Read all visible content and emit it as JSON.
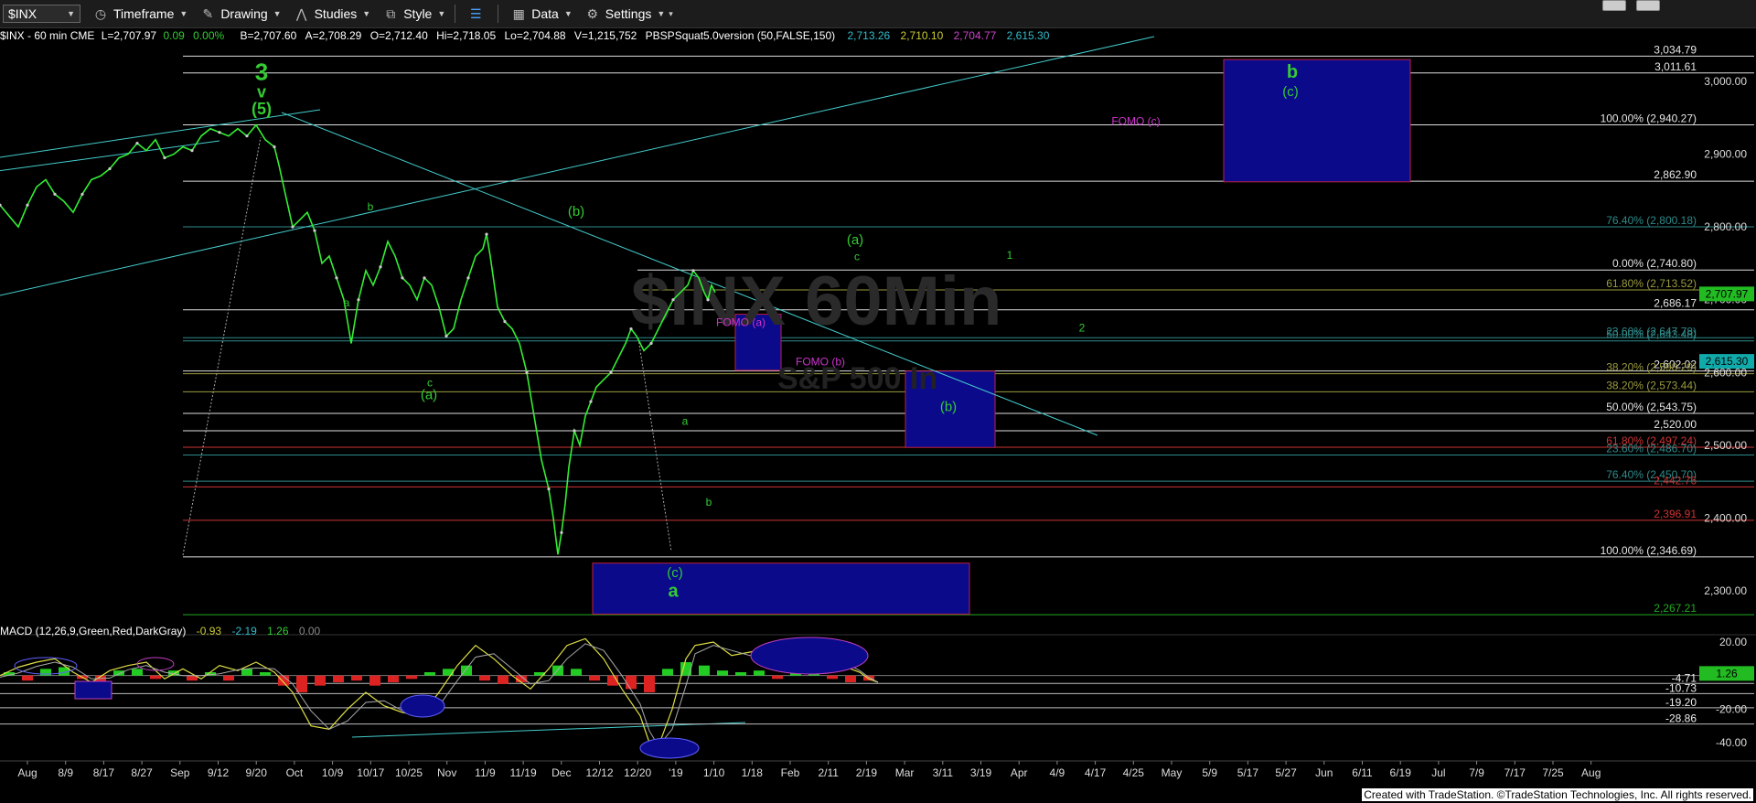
{
  "toolbar": {
    "symbol": "$INX",
    "timeframe": "Timeframe",
    "drawing": "Drawing",
    "studies": "Studies",
    "style": "Style",
    "data": "Data",
    "settings": "Settings"
  },
  "header": {
    "symbol_info": "$INX - 60 min  CME",
    "last": "L=2,707.97",
    "chg": "0.09",
    "pct": "0.00%",
    "bid": "B=2,707.60",
    "ask": "A=2,708.29",
    "open": "O=2,712.40",
    "high": "Hi=2,718.05",
    "low": "Lo=2,704.88",
    "vol": "V=1,215,752",
    "study": "PBSPSquat5.0version (50,FALSE,150)",
    "v1": "2,713.26",
    "v2": "2,710.10",
    "v3": "2,704.77",
    "v4": "2,615.30"
  },
  "macd_header": {
    "label": "MACD (12,26,9,Green,Red,DarkGray)",
    "v1": "-0.93",
    "v2": "-2.19",
    "v3": "1.26",
    "v4": "0.00"
  },
  "watermark": {
    "line1": "$INX 60Min",
    "line2": "S&P 500 In"
  },
  "footer": "Created with TradeStation. ©TradeStation Technologies, Inc. All rights reserved.",
  "chart_data": {
    "type": "line",
    "title": "$INX - 60 min",
    "ylim": [
      2240,
      3060
    ],
    "price_ticks": [
      "3,000.00",
      "2,900.00",
      "2,800.00",
      "2,700.00",
      "2,600.00",
      "2,500.00",
      "2,400.00",
      "2,300.00"
    ],
    "x_ticks": [
      "Aug",
      "8/9",
      "8/17",
      "8/27",
      "Sep",
      "9/12",
      "9/20",
      "Oct",
      "10/9",
      "10/17",
      "10/25",
      "Nov",
      "11/9",
      "11/19",
      "Dec",
      "12/12",
      "12/20",
      "'19",
      "1/10",
      "1/18",
      "Feb",
      "2/11",
      "2/19",
      "Mar",
      "3/11",
      "3/19",
      "Apr",
      "4/9",
      "4/17",
      "4/25",
      "May",
      "5/9",
      "5/17",
      "5/27",
      "Jun",
      "6/11",
      "6/19",
      "Jul",
      "7/9",
      "7/17",
      "7/25",
      "Aug"
    ],
    "price_series": [
      [
        0,
        2830
      ],
      [
        10,
        2815
      ],
      [
        20,
        2800
      ],
      [
        30,
        2830
      ],
      [
        40,
        2855
      ],
      [
        50,
        2865
      ],
      [
        60,
        2845
      ],
      [
        70,
        2835
      ],
      [
        80,
        2820
      ],
      [
        90,
        2845
      ],
      [
        100,
        2865
      ],
      [
        110,
        2870
      ],
      [
        120,
        2880
      ],
      [
        130,
        2895
      ],
      [
        140,
        2900
      ],
      [
        150,
        2915
      ],
      [
        160,
        2905
      ],
      [
        170,
        2920
      ],
      [
        180,
        2895
      ],
      [
        190,
        2900
      ],
      [
        200,
        2910
      ],
      [
        210,
        2905
      ],
      [
        220,
        2925
      ],
      [
        230,
        2935
      ],
      [
        240,
        2930
      ],
      [
        250,
        2925
      ],
      [
        260,
        2935
      ],
      [
        270,
        2925
      ],
      [
        280,
        2940
      ],
      [
        290,
        2920
      ],
      [
        300,
        2910
      ],
      [
        305,
        2885
      ],
      [
        312,
        2845
      ],
      [
        320,
        2800
      ],
      [
        328,
        2810
      ],
      [
        336,
        2820
      ],
      [
        344,
        2795
      ],
      [
        352,
        2750
      ],
      [
        360,
        2760
      ],
      [
        368,
        2730
      ],
      [
        376,
        2700
      ],
      [
        384,
        2640
      ],
      [
        392,
        2700
      ],
      [
        400,
        2740
      ],
      [
        408,
        2720
      ],
      [
        416,
        2745
      ],
      [
        424,
        2780
      ],
      [
        432,
        2760
      ],
      [
        440,
        2730
      ],
      [
        448,
        2720
      ],
      [
        456,
        2700
      ],
      [
        464,
        2730
      ],
      [
        472,
        2720
      ],
      [
        480,
        2690
      ],
      [
        488,
        2650
      ],
      [
        496,
        2660
      ],
      [
        504,
        2700
      ],
      [
        512,
        2730
      ],
      [
        520,
        2760
      ],
      [
        528,
        2770
      ],
      [
        532,
        2790
      ],
      [
        536,
        2760
      ],
      [
        544,
        2690
      ],
      [
        552,
        2670
      ],
      [
        560,
        2660
      ],
      [
        568,
        2640
      ],
      [
        576,
        2600
      ],
      [
        584,
        2540
      ],
      [
        592,
        2480
      ],
      [
        600,
        2440
      ],
      [
        605,
        2400
      ],
      [
        610,
        2350
      ],
      [
        614,
        2380
      ],
      [
        618,
        2420
      ],
      [
        622,
        2470
      ],
      [
        628,
        2520
      ],
      [
        634,
        2500
      ],
      [
        640,
        2540
      ],
      [
        646,
        2560
      ],
      [
        652,
        2580
      ],
      [
        660,
        2590
      ],
      [
        668,
        2600
      ],
      [
        676,
        2620
      ],
      [
        684,
        2640
      ],
      [
        690,
        2660
      ],
      [
        696,
        2650
      ],
      [
        704,
        2630
      ],
      [
        712,
        2640
      ],
      [
        720,
        2660
      ],
      [
        728,
        2680
      ],
      [
        736,
        2700
      ],
      [
        744,
        2710
      ],
      [
        752,
        2720
      ],
      [
        758,
        2740
      ],
      [
        764,
        2730
      ],
      [
        770,
        2710
      ],
      [
        774,
        2700
      ],
      [
        778,
        2720
      ],
      [
        782,
        2710
      ]
    ],
    "levels": [
      {
        "label": "3,034.79",
        "price": 3034.79,
        "color": "#dddddd"
      },
      {
        "label": "3,011.61",
        "price": 3011.61,
        "color": "#dddddd"
      },
      {
        "label": "100.00% (2,940.27)",
        "price": 2940.27,
        "color": "#dddddd"
      },
      {
        "label": "2,862.90",
        "price": 2862.9,
        "color": "#dddddd"
      },
      {
        "label": "76.40% (2,800.18)",
        "price": 2800.18,
        "color": "#2f8a8a"
      },
      {
        "label": "0.00% (2,740.80)",
        "price": 2740.8,
        "color": "#dddddd"
      },
      {
        "label": "61.80% (2,713.52)",
        "price": 2713.52,
        "color": "#9a9a40"
      },
      {
        "label": "2,686.17",
        "price": 2686.17,
        "color": "#dddddd"
      },
      {
        "label": "23.60% (2,647.78)",
        "price": 2647.78,
        "color": "#2f8a8a"
      },
      {
        "label": "50.00% (2,643.48)",
        "price": 2643.48,
        "color": "#2f8a8a"
      },
      {
        "label": "2,602.02",
        "price": 2602.02,
        "color": "#dddddd"
      },
      {
        "label": "38.20% (2,598.29)",
        "price": 2598.29,
        "color": "#9a9a40"
      },
      {
        "label": "38.20% (2,573.44)",
        "price": 2573.44,
        "color": "#9a9a40"
      },
      {
        "label": "50.00% (2,543.75)",
        "price": 2543.75,
        "color": "#dddddd"
      },
      {
        "label": "2,520.00",
        "price": 2520.0,
        "color": "#dddddd"
      },
      {
        "label": "61.80% (2,497.24)",
        "price": 2497.24,
        "color": "#cc3333"
      },
      {
        "label": "23.60% (2,486.70)",
        "price": 2486.7,
        "color": "#2f8a8a"
      },
      {
        "label": "76.40% (2,450.70)",
        "price": 2450.7,
        "color": "#2f8a8a"
      },
      {
        "label": "2,442.76",
        "price": 2442.76,
        "color": "#cc3333"
      },
      {
        "label": "2,396.91",
        "price": 2396.91,
        "color": "#cc3333"
      },
      {
        "label": "100.00% (2,346.69)",
        "price": 2346.69,
        "color": "#dddddd"
      },
      {
        "label": "2,267.21",
        "price": 2267.21,
        "color": "#22aa22"
      }
    ],
    "last_price": {
      "label": "2,707.97",
      "price": 2707.97
    },
    "alt_price": {
      "label": "2,615.30",
      "price": 2615.3
    },
    "boxes": [
      {
        "name": "target-box-b",
        "x1": 1338,
        "x2": 1542,
        "p1": 3030,
        "p2": 2862
      },
      {
        "name": "target-box-b-wave",
        "x1": 990,
        "x2": 1088,
        "p1": 2602,
        "p2": 2497
      },
      {
        "name": "target-box-a",
        "x1": 648,
        "x2": 1060,
        "p1": 2338,
        "p2": 2268
      },
      {
        "name": "fomo-box-a",
        "x1": 804,
        "x2": 854,
        "p1": 2680,
        "p2": 2603
      }
    ],
    "annotations": [
      {
        "text": "3",
        "x": 286,
        "p": 3002,
        "color": "#33cc33",
        "size": 26,
        "bold": true
      },
      {
        "text": "v",
        "x": 286,
        "p": 2978,
        "color": "#33cc33",
        "size": 18,
        "bold": true
      },
      {
        "text": "(5)",
        "x": 286,
        "p": 2955,
        "color": "#33cc33",
        "size": 18,
        "bold": true
      },
      {
        "text": "b",
        "x": 1413,
        "p": 3005,
        "color": "#33cc33",
        "size": 20,
        "bold": true
      },
      {
        "text": "(c)",
        "x": 1411,
        "p": 2980,
        "color": "#33cc33",
        "size": 15,
        "bold": false
      },
      {
        "text": "FOMO (c)",
        "x": 1242,
        "p": 2940,
        "color": "#cc33cc",
        "size": 12,
        "bold": false
      },
      {
        "text": "b",
        "x": 405,
        "p": 2823,
        "color": "#33cc33",
        "size": 12,
        "bold": false
      },
      {
        "text": "(b)",
        "x": 630,
        "p": 2815,
        "color": "#33cc33",
        "size": 15,
        "bold": false
      },
      {
        "text": "(a)",
        "x": 935,
        "p": 2776,
        "color": "#33cc33",
        "size": 15,
        "bold": false
      },
      {
        "text": "c",
        "x": 937,
        "p": 2754,
        "color": "#33cc33",
        "size": 12,
        "bold": false
      },
      {
        "text": "1",
        "x": 1104,
        "p": 2756,
        "color": "#33cc33",
        "size": 12,
        "bold": false
      },
      {
        "text": "a",
        "x": 379,
        "p": 2691,
        "color": "#33cc33",
        "size": 12,
        "bold": false
      },
      {
        "text": "2",
        "x": 1183,
        "p": 2656,
        "color": "#33cc33",
        "size": 12,
        "bold": false
      },
      {
        "text": "FOMO (a)",
        "x": 810,
        "p": 2664,
        "color": "#cc33cc",
        "size": 12,
        "bold": false
      },
      {
        "text": "FOMO (b)",
        "x": 897,
        "p": 2610,
        "color": "#cc33cc",
        "size": 12,
        "bold": false
      },
      {
        "text": "c",
        "x": 470,
        "p": 2581,
        "color": "#33cc33",
        "size": 12,
        "bold": false
      },
      {
        "text": "(a)",
        "x": 469,
        "p": 2563,
        "color": "#33cc33",
        "size": 15,
        "bold": false
      },
      {
        "text": "(b)",
        "x": 1037,
        "p": 2547,
        "color": "#33cc33",
        "size": 15,
        "bold": false
      },
      {
        "text": "a",
        "x": 749,
        "p": 2528,
        "color": "#33cc33",
        "size": 12,
        "bold": false
      },
      {
        "text": "b",
        "x": 775,
        "p": 2417,
        "color": "#33cc33",
        "size": 12,
        "bold": false
      },
      {
        "text": "(c)",
        "x": 738,
        "p": 2319,
        "color": "#33cc33",
        "size": 15,
        "bold": false
      },
      {
        "text": "a",
        "x": 736,
        "p": 2292,
        "color": "#33cc33",
        "size": 20,
        "bold": true
      }
    ],
    "macd": {
      "ylim": [
        -48,
        28
      ],
      "ticks": [
        "20.00",
        "-20.00",
        "-40.00"
      ],
      "levels": [
        {
          "label": "-4.71",
          "value": -4.71
        },
        {
          "label": "-10.73",
          "value": -10.73
        },
        {
          "label": "-19.20",
          "value": -19.2
        },
        {
          "label": "-28.86",
          "value": -28.86
        }
      ],
      "badge": {
        "label": "1.26",
        "value": 1.26
      },
      "macd_line": [
        [
          0,
          0
        ],
        [
          20,
          5
        ],
        [
          40,
          8
        ],
        [
          60,
          10
        ],
        [
          80,
          2
        ],
        [
          100,
          -4
        ],
        [
          120,
          3
        ],
        [
          140,
          6
        ],
        [
          160,
          8
        ],
        [
          180,
          -2
        ],
        [
          200,
          4
        ],
        [
          220,
          -2
        ],
        [
          240,
          6
        ],
        [
          260,
          3
        ],
        [
          280,
          8
        ],
        [
          300,
          2
        ],
        [
          320,
          -10
        ],
        [
          340,
          -30
        ],
        [
          360,
          -32
        ],
        [
          380,
          -20
        ],
        [
          400,
          -10
        ],
        [
          420,
          -18
        ],
        [
          440,
          -22
        ],
        [
          460,
          -24
        ],
        [
          480,
          -10
        ],
        [
          500,
          6
        ],
        [
          520,
          18
        ],
        [
          540,
          10
        ],
        [
          560,
          0
        ],
        [
          580,
          -8
        ],
        [
          600,
          4
        ],
        [
          620,
          18
        ],
        [
          640,
          22
        ],
        [
          660,
          10
        ],
        [
          680,
          -8
        ],
        [
          700,
          -24
        ],
        [
          710,
          -40
        ],
        [
          720,
          -42
        ],
        [
          735,
          -20
        ],
        [
          750,
          10
        ],
        [
          760,
          18
        ],
        [
          780,
          20
        ],
        [
          800,
          12
        ],
        [
          820,
          14
        ],
        [
          840,
          16
        ],
        [
          860,
          8
        ],
        [
          880,
          12
        ],
        [
          900,
          14
        ],
        [
          920,
          6
        ],
        [
          940,
          2
        ],
        [
          950,
          -2
        ],
        [
          960,
          -4
        ]
      ],
      "histogram": [
        [
          10,
          2
        ],
        [
          30,
          -3
        ],
        [
          50,
          4
        ],
        [
          70,
          5
        ],
        [
          90,
          -2
        ],
        [
          110,
          -5
        ],
        [
          130,
          3
        ],
        [
          150,
          4
        ],
        [
          170,
          -2
        ],
        [
          190,
          3
        ],
        [
          210,
          -3
        ],
        [
          230,
          2
        ],
        [
          250,
          -3
        ],
        [
          270,
          4
        ],
        [
          290,
          2
        ],
        [
          310,
          -6
        ],
        [
          330,
          -10
        ],
        [
          350,
          -6
        ],
        [
          370,
          -4
        ],
        [
          390,
          -3
        ],
        [
          410,
          -6
        ],
        [
          430,
          -4
        ],
        [
          450,
          -2
        ],
        [
          470,
          2
        ],
        [
          490,
          4
        ],
        [
          510,
          6
        ],
        [
          530,
          -3
        ],
        [
          550,
          -5
        ],
        [
          570,
          -4
        ],
        [
          590,
          2
        ],
        [
          610,
          6
        ],
        [
          630,
          4
        ],
        [
          650,
          -3
        ],
        [
          670,
          -6
        ],
        [
          690,
          -8
        ],
        [
          710,
          -10
        ],
        [
          730,
          4
        ],
        [
          750,
          8
        ],
        [
          770,
          6
        ],
        [
          790,
          3
        ],
        [
          810,
          2
        ],
        [
          830,
          3
        ],
        [
          850,
          -2
        ],
        [
          870,
          2
        ],
        [
          890,
          3
        ],
        [
          910,
          -2
        ],
        [
          930,
          -4
        ],
        [
          950,
          -3
        ]
      ]
    }
  }
}
